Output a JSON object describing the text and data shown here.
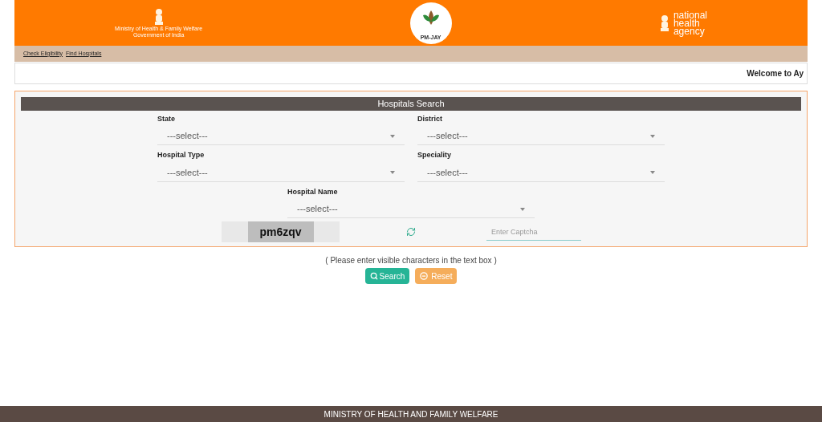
{
  "header": {
    "ministry_lines": [
      "Ministry of Health & Family Welfare",
      "Government of India"
    ],
    "center_logo_text": "PM-JAY",
    "agency_lines": [
      "national",
      "health",
      "agency"
    ]
  },
  "nav": [
    {
      "label": "Check Eligibility"
    },
    {
      "label": "Find Hospitals"
    }
  ],
  "welcome": "Welcome to Ay",
  "panel": {
    "title": "Hospitals Search",
    "rows": [
      [
        {
          "label": "State",
          "value": "---select---"
        },
        {
          "label": "District",
          "value": "---select---"
        }
      ],
      [
        {
          "label": "Hospital Type",
          "value": "---select---"
        },
        {
          "label": "Speciality",
          "value": "---select---"
        }
      ],
      [
        {
          "label": "Hospital Name",
          "value": "---select---"
        }
      ]
    ],
    "captcha": {
      "text": "pm6zqv",
      "placeholder": "Enter Captcha"
    }
  },
  "hint": "( Please enter visible characters in the text box )",
  "buttons": [
    {
      "label": "Search",
      "kind": "search"
    },
    {
      "label": "Reset",
      "kind": "reset"
    }
  ],
  "footer": "MINISTRY OF HEALTH AND FAMILY WELFARE"
}
